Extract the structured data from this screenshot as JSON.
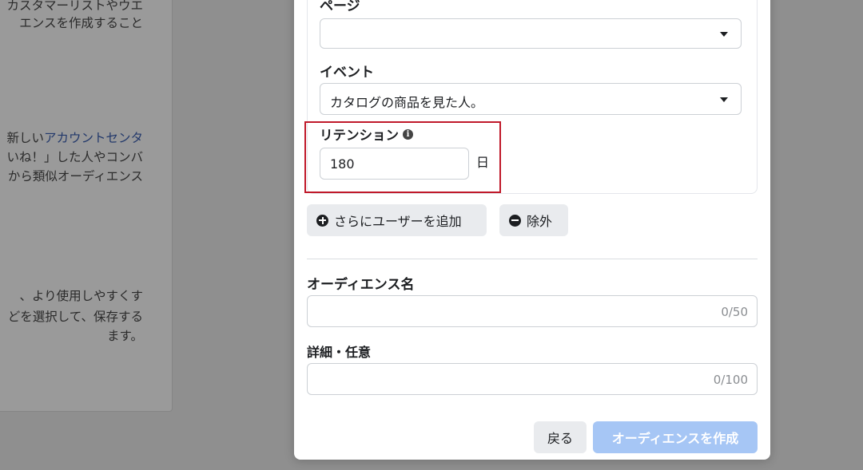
{
  "background": {
    "lines": [
      {
        "text": "カスタマーリストやウエ",
        "link": ""
      },
      {
        "text": "エンスを作成すること",
        "link": ""
      },
      {
        "text": "新しい",
        "link": "アカウントセンタ"
      },
      {
        "text": "いね！」した人やコンバ",
        "link": ""
      },
      {
        "text": "から類似オーディエンス",
        "link": ""
      },
      {
        "text": "、より使用しやすくす",
        "link": ""
      },
      {
        "text": "どを選択して、保存する",
        "link": ""
      },
      {
        "text": "ます。",
        "link": ""
      }
    ]
  },
  "modal": {
    "page_label": "ページ",
    "page_value": "",
    "event_label": "イベント",
    "event_value": "カタログの商品を見た人。",
    "retention_label": "リテンション",
    "retention_value": "180",
    "retention_unit": "日",
    "add_users_label": "さらにユーザーを追加",
    "exclude_label": "除外",
    "audience_name_label": "オーディエンス名",
    "audience_name_counter": "0/50",
    "details_label": "詳細・任意",
    "details_counter": "0/100",
    "back_label": "戻る",
    "create_label": "オーディエンスを作成"
  },
  "colors": {
    "highlight": "#c0192a",
    "create_button_disabled": "#a6c6f5",
    "link": "#23396b"
  },
  "icons": {
    "info": "info-icon",
    "plus": "plus-circle-icon",
    "minus": "minus-circle-icon",
    "caret": "caret-down-icon"
  }
}
